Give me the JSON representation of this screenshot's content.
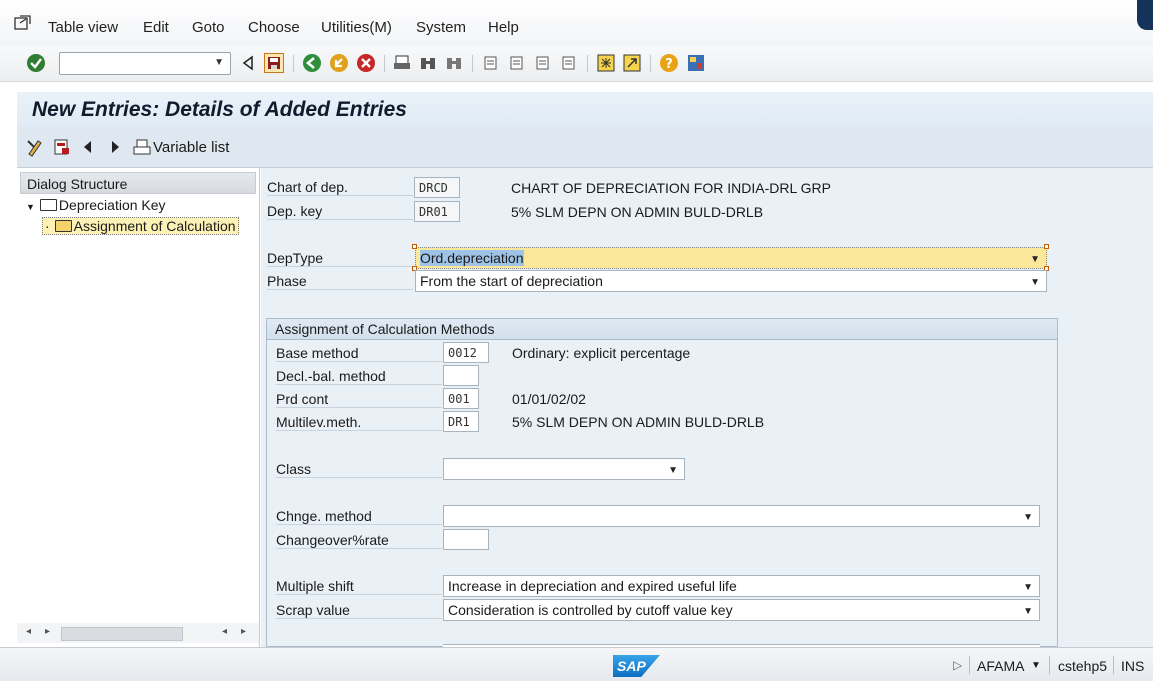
{
  "menu": {
    "items": [
      "Table view",
      "Edit",
      "Goto",
      "Choose",
      "Utilities(M)",
      "System",
      "Help"
    ]
  },
  "toolbar": {
    "command_field_value": ""
  },
  "screen": {
    "title": "New Entries: Details of Added Entries"
  },
  "appbar": {
    "variable_list_label": "Variable list"
  },
  "dialog_structure": {
    "header": "Dialog Structure",
    "items": [
      {
        "label": "Depreciation Key",
        "level": 0,
        "expanded": true,
        "selected": false
      },
      {
        "label": "Assignment of Calculation",
        "level": 1,
        "expanded": false,
        "selected": true
      }
    ]
  },
  "header_fields": {
    "chart_of_dep": {
      "label": "Chart of dep.",
      "value": "DRCD",
      "description": "CHART OF DEPRECIATION FOR INDIA-DRL GRP"
    },
    "dep_key": {
      "label": "Dep. key",
      "value": "DR01",
      "description": "5% SLM DEPN ON ADMIN BULD-DRLB"
    }
  },
  "selection_fields": {
    "dep_type": {
      "label": "DepType",
      "value": "Ord.depreciation"
    },
    "phase": {
      "label": "Phase",
      "value": "From the start of depreciation"
    }
  },
  "calc_methods": {
    "title": "Assignment of Calculation Methods",
    "base_method": {
      "label": "Base method",
      "value": "0012",
      "description": "Ordinary: explicit percentage"
    },
    "decl_bal_method": {
      "label": "Decl.-bal. method",
      "value": ""
    },
    "prd_cont": {
      "label": "Prd cont",
      "value": "001",
      "description": "01/01/02/02"
    },
    "multilev_meth": {
      "label": "Multilev.meth.",
      "value": "DR1",
      "description": "5% SLM DEPN ON ADMIN BULD-DRLB"
    },
    "class": {
      "label": "Class",
      "value": ""
    },
    "chnge_method": {
      "label": "Chnge. method",
      "value": ""
    },
    "changeover_rate": {
      "label": "Changeover%rate",
      "value": ""
    },
    "multiple_shift": {
      "label": "Multiple shift",
      "value": "Increase in depreciation and expired useful life"
    },
    "scrap_value": {
      "label": "Scrap value",
      "value": "Consideration is controlled by cutoff value key"
    }
  },
  "status_bar": {
    "logo": "SAP",
    "transaction": "AFAMA",
    "server": "cstehp5",
    "mode": "INS"
  },
  "colors": {
    "focus_field": "#fbe89a",
    "selected_tree_item": "#fdf2b5",
    "content_bg": "#e9f0f6"
  }
}
